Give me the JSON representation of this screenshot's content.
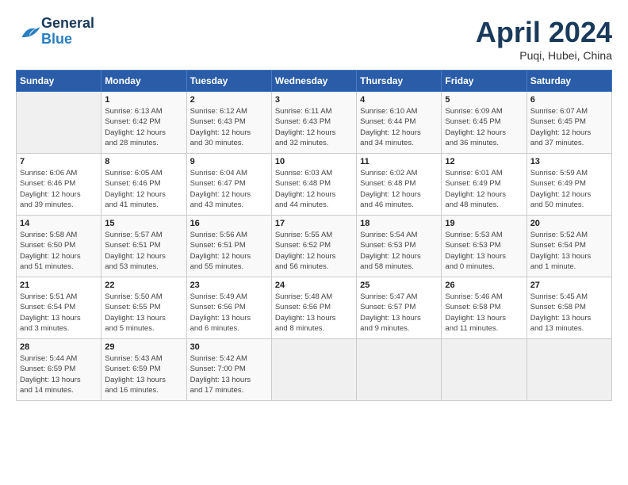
{
  "header": {
    "logo_general": "General",
    "logo_blue": "Blue",
    "month_title": "April 2024",
    "subtitle": "Puqi, Hubei, China"
  },
  "days_of_week": [
    "Sunday",
    "Monday",
    "Tuesday",
    "Wednesday",
    "Thursday",
    "Friday",
    "Saturday"
  ],
  "weeks": [
    [
      {
        "day": "",
        "info": ""
      },
      {
        "day": "1",
        "info": "Sunrise: 6:13 AM\nSunset: 6:42 PM\nDaylight: 12 hours\nand 28 minutes."
      },
      {
        "day": "2",
        "info": "Sunrise: 6:12 AM\nSunset: 6:43 PM\nDaylight: 12 hours\nand 30 minutes."
      },
      {
        "day": "3",
        "info": "Sunrise: 6:11 AM\nSunset: 6:43 PM\nDaylight: 12 hours\nand 32 minutes."
      },
      {
        "day": "4",
        "info": "Sunrise: 6:10 AM\nSunset: 6:44 PM\nDaylight: 12 hours\nand 34 minutes."
      },
      {
        "day": "5",
        "info": "Sunrise: 6:09 AM\nSunset: 6:45 PM\nDaylight: 12 hours\nand 36 minutes."
      },
      {
        "day": "6",
        "info": "Sunrise: 6:07 AM\nSunset: 6:45 PM\nDaylight: 12 hours\nand 37 minutes."
      }
    ],
    [
      {
        "day": "7",
        "info": "Sunrise: 6:06 AM\nSunset: 6:46 PM\nDaylight: 12 hours\nand 39 minutes."
      },
      {
        "day": "8",
        "info": "Sunrise: 6:05 AM\nSunset: 6:46 PM\nDaylight: 12 hours\nand 41 minutes."
      },
      {
        "day": "9",
        "info": "Sunrise: 6:04 AM\nSunset: 6:47 PM\nDaylight: 12 hours\nand 43 minutes."
      },
      {
        "day": "10",
        "info": "Sunrise: 6:03 AM\nSunset: 6:48 PM\nDaylight: 12 hours\nand 44 minutes."
      },
      {
        "day": "11",
        "info": "Sunrise: 6:02 AM\nSunset: 6:48 PM\nDaylight: 12 hours\nand 46 minutes."
      },
      {
        "day": "12",
        "info": "Sunrise: 6:01 AM\nSunset: 6:49 PM\nDaylight: 12 hours\nand 48 minutes."
      },
      {
        "day": "13",
        "info": "Sunrise: 5:59 AM\nSunset: 6:49 PM\nDaylight: 12 hours\nand 50 minutes."
      }
    ],
    [
      {
        "day": "14",
        "info": "Sunrise: 5:58 AM\nSunset: 6:50 PM\nDaylight: 12 hours\nand 51 minutes."
      },
      {
        "day": "15",
        "info": "Sunrise: 5:57 AM\nSunset: 6:51 PM\nDaylight: 12 hours\nand 53 minutes."
      },
      {
        "day": "16",
        "info": "Sunrise: 5:56 AM\nSunset: 6:51 PM\nDaylight: 12 hours\nand 55 minutes."
      },
      {
        "day": "17",
        "info": "Sunrise: 5:55 AM\nSunset: 6:52 PM\nDaylight: 12 hours\nand 56 minutes."
      },
      {
        "day": "18",
        "info": "Sunrise: 5:54 AM\nSunset: 6:53 PM\nDaylight: 12 hours\nand 58 minutes."
      },
      {
        "day": "19",
        "info": "Sunrise: 5:53 AM\nSunset: 6:53 PM\nDaylight: 13 hours\nand 0 minutes."
      },
      {
        "day": "20",
        "info": "Sunrise: 5:52 AM\nSunset: 6:54 PM\nDaylight: 13 hours\nand 1 minute."
      }
    ],
    [
      {
        "day": "21",
        "info": "Sunrise: 5:51 AM\nSunset: 6:54 PM\nDaylight: 13 hours\nand 3 minutes."
      },
      {
        "day": "22",
        "info": "Sunrise: 5:50 AM\nSunset: 6:55 PM\nDaylight: 13 hours\nand 5 minutes."
      },
      {
        "day": "23",
        "info": "Sunrise: 5:49 AM\nSunset: 6:56 PM\nDaylight: 13 hours\nand 6 minutes."
      },
      {
        "day": "24",
        "info": "Sunrise: 5:48 AM\nSunset: 6:56 PM\nDaylight: 13 hours\nand 8 minutes."
      },
      {
        "day": "25",
        "info": "Sunrise: 5:47 AM\nSunset: 6:57 PM\nDaylight: 13 hours\nand 9 minutes."
      },
      {
        "day": "26",
        "info": "Sunrise: 5:46 AM\nSunset: 6:58 PM\nDaylight: 13 hours\nand 11 minutes."
      },
      {
        "day": "27",
        "info": "Sunrise: 5:45 AM\nSunset: 6:58 PM\nDaylight: 13 hours\nand 13 minutes."
      }
    ],
    [
      {
        "day": "28",
        "info": "Sunrise: 5:44 AM\nSunset: 6:59 PM\nDaylight: 13 hours\nand 14 minutes."
      },
      {
        "day": "29",
        "info": "Sunrise: 5:43 AM\nSunset: 6:59 PM\nDaylight: 13 hours\nand 16 minutes."
      },
      {
        "day": "30",
        "info": "Sunrise: 5:42 AM\nSunset: 7:00 PM\nDaylight: 13 hours\nand 17 minutes."
      },
      {
        "day": "",
        "info": ""
      },
      {
        "day": "",
        "info": ""
      },
      {
        "day": "",
        "info": ""
      },
      {
        "day": "",
        "info": ""
      }
    ]
  ]
}
